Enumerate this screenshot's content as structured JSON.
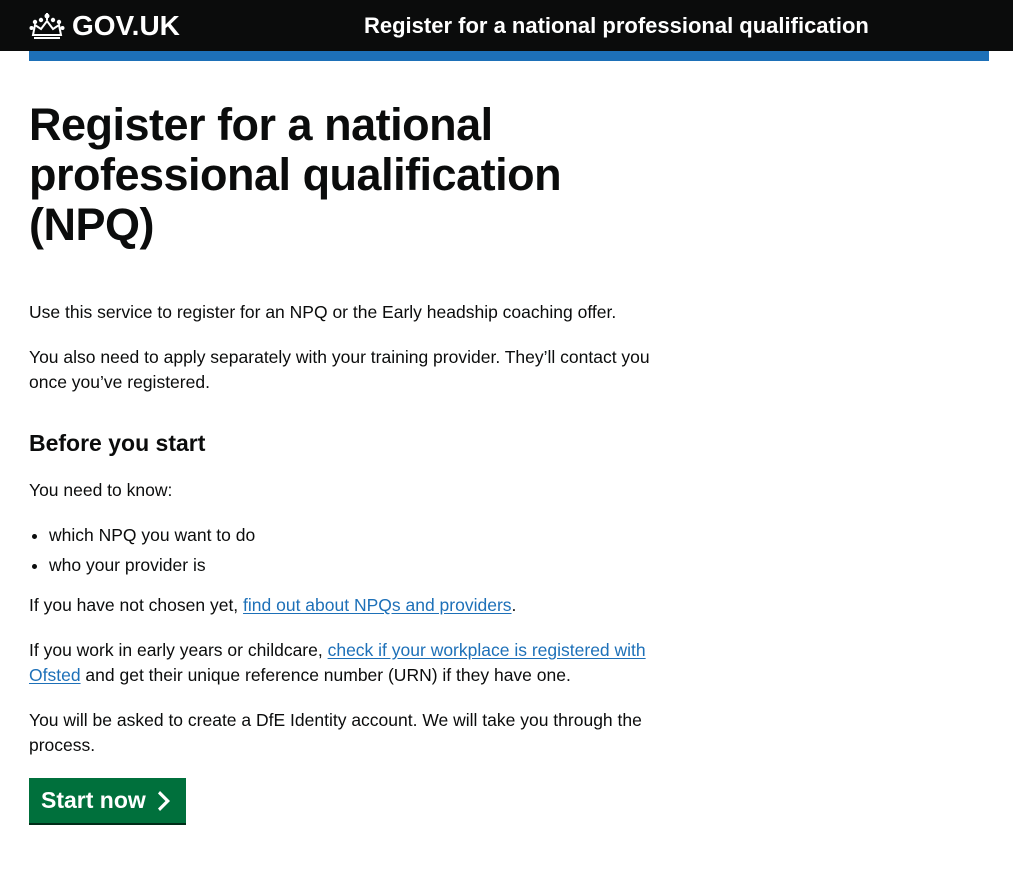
{
  "header": {
    "logo_text": "GOV.UK",
    "logo_icon": "crown-icon",
    "service_name": "Register for a national professional qualification"
  },
  "main": {
    "title": "Register for a national professional qualification (NPQ)",
    "intro": "Use this service to register for an NPQ or the Early headship coaching offer.",
    "apply_separately": "You also need to apply separately with your training provider. They’ll contact you once you’ve registered.",
    "before_heading": "Before you start",
    "need_to_know": "You need to know:",
    "list_items": [
      "which NPQ you want to do",
      "who your provider is"
    ],
    "not_chosen": {
      "prefix": "If you have not chosen yet, ",
      "link": "find out about NPQs and providers",
      "suffix": "."
    },
    "early_years": {
      "prefix": "If you work in early years or childcare, ",
      "link": "check if your workplace is registered with Ofsted",
      "suffix": " and get their unique reference number (URN) if they have one."
    },
    "identity": "You will be asked to create a DfE Identity account. We will take you through the process.",
    "start_button": "Start now",
    "start_icon": "chevron-right-icon"
  },
  "colors": {
    "header_bg": "#0b0c0c",
    "header_border": "#1d70b8",
    "link": "#1d70b8",
    "button": "#00703c",
    "text": "#0b0c0c"
  }
}
